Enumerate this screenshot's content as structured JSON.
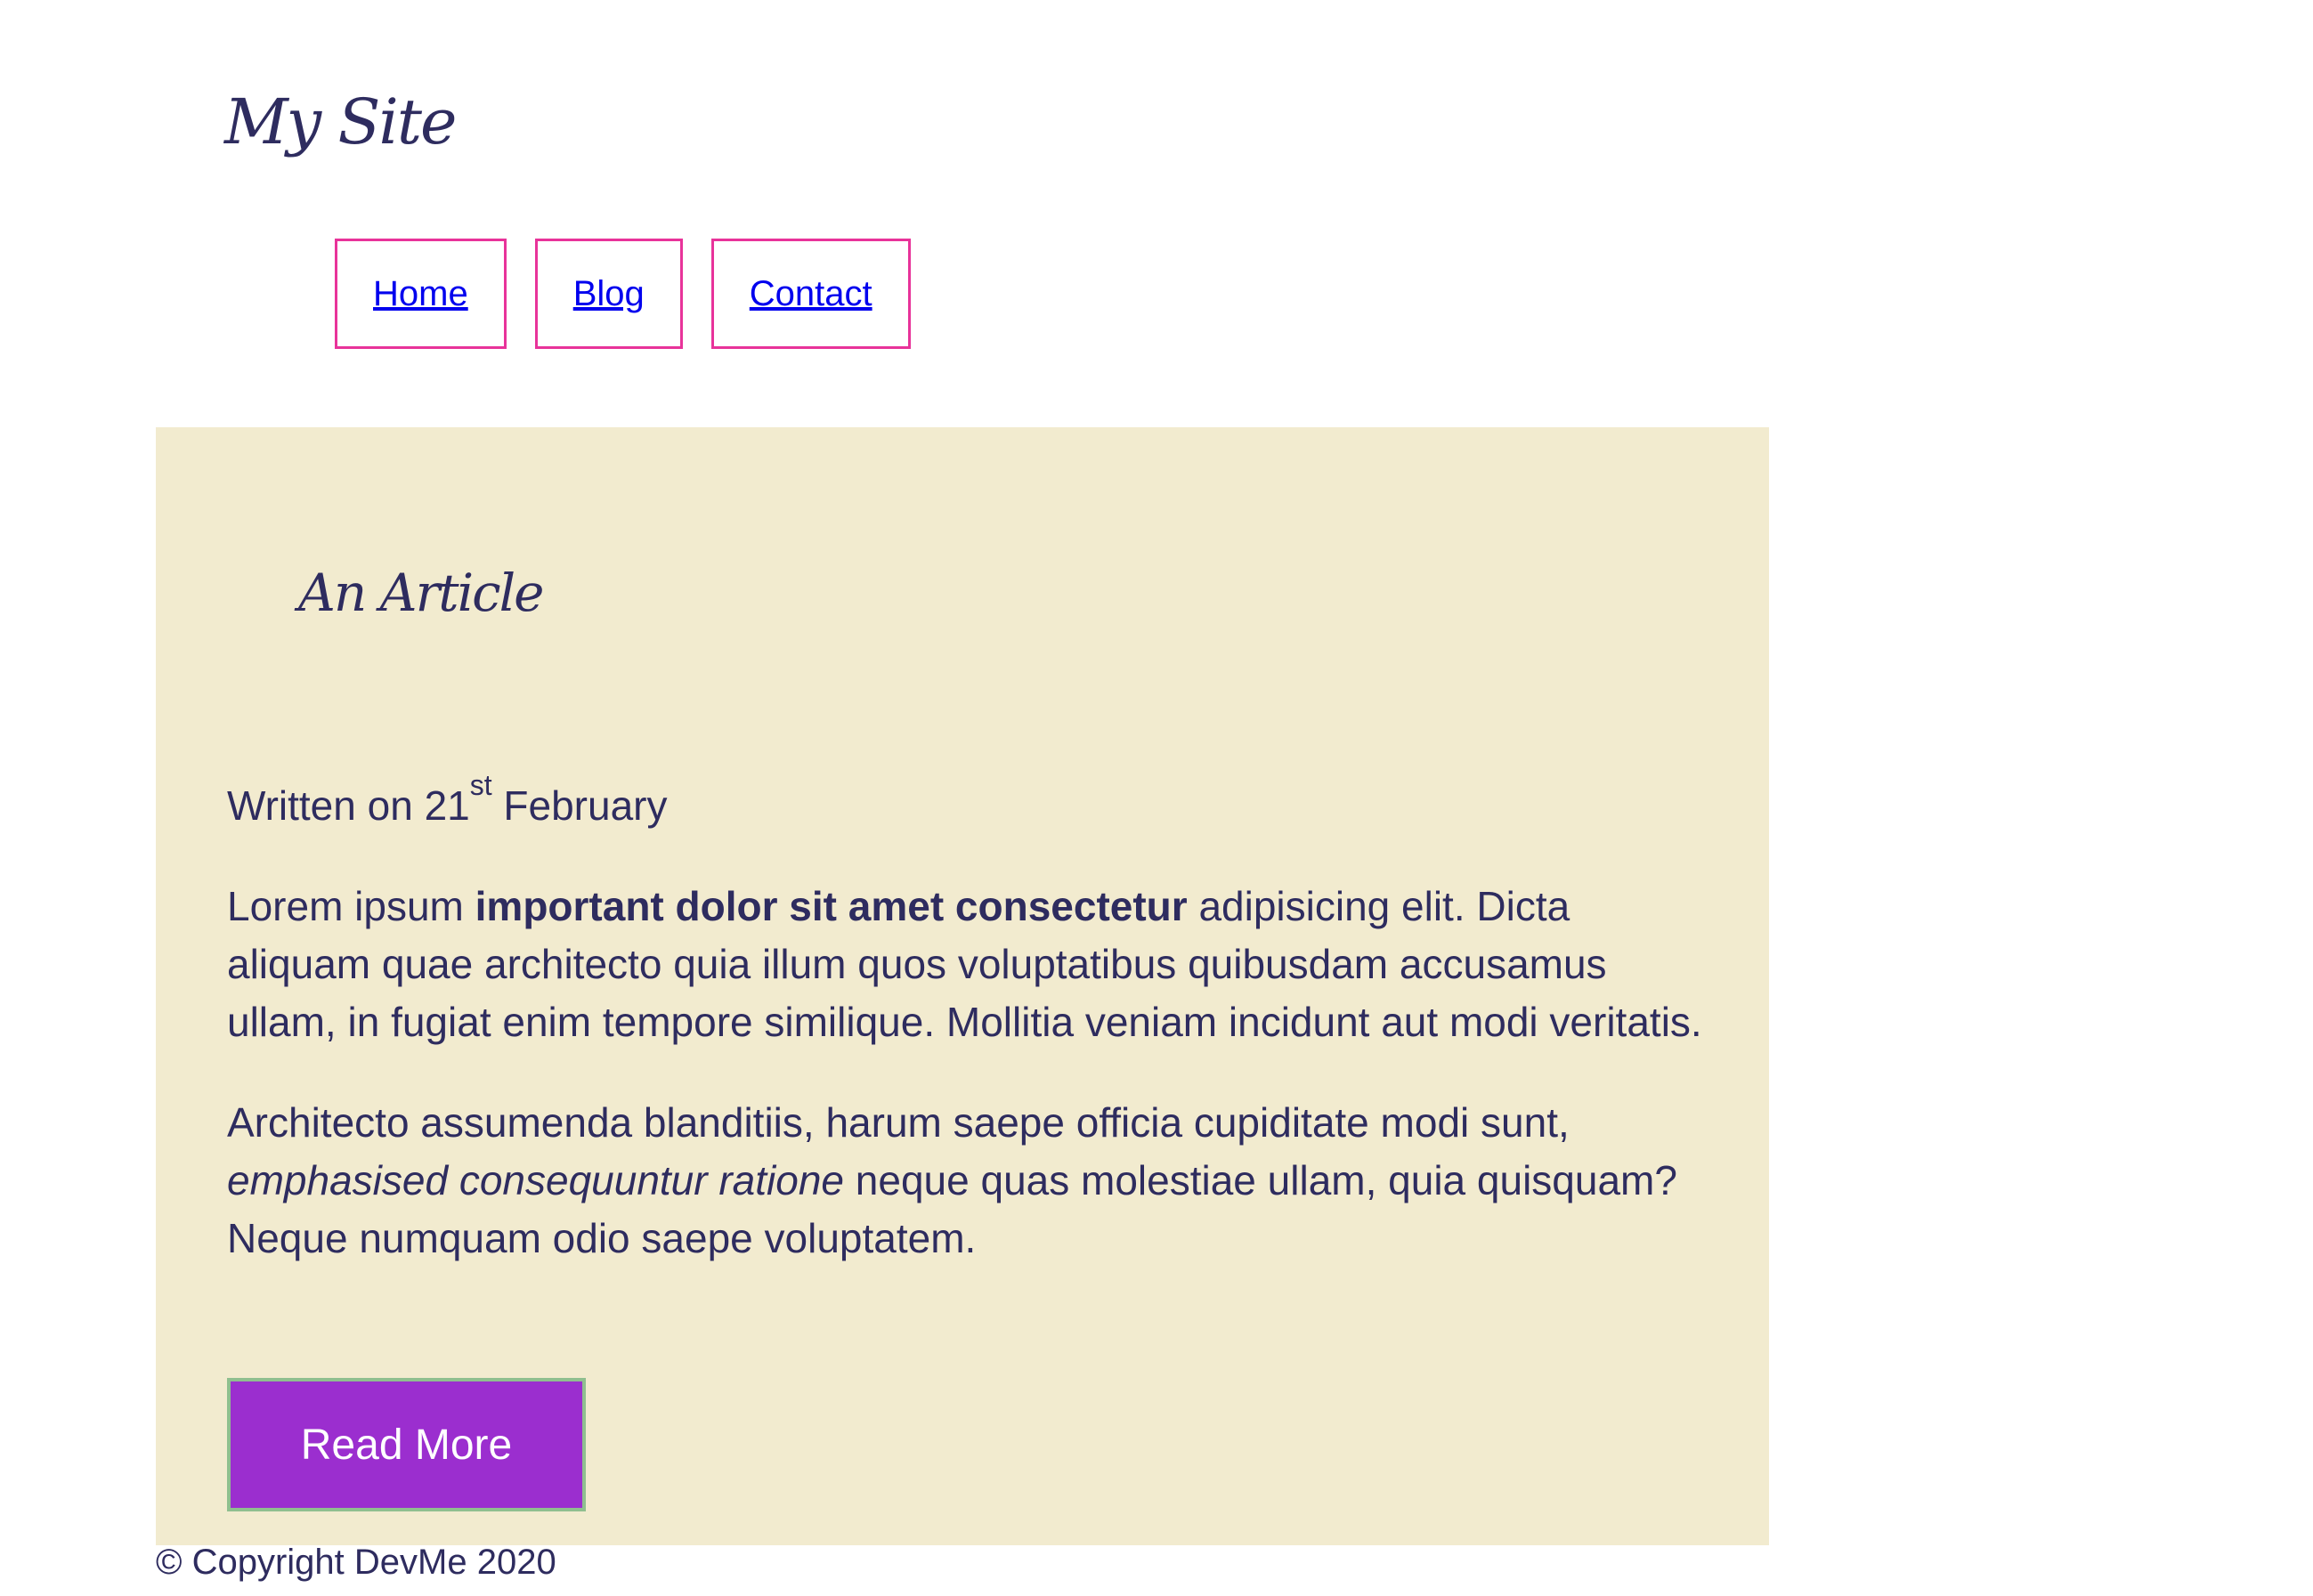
{
  "header": {
    "site_title": "My Site"
  },
  "nav": {
    "items": [
      {
        "label": "Home"
      },
      {
        "label": "Blog"
      },
      {
        "label": "Contact"
      }
    ]
  },
  "article": {
    "title": "An Article",
    "meta": {
      "prefix": "Written on 21",
      "ordinal_suffix": "st",
      "month": "February"
    },
    "paragraph1": {
      "before": "Lorem ipsum ",
      "bold": "important dolor sit amet consectetur",
      "after": " adipisicing elit. Dicta aliquam quae architecto quia illum quos voluptatibus quibusdam accusamus ullam, in fugiat enim tempore similique. Mollitia veniam incidunt aut modi veritatis."
    },
    "paragraph2": {
      "before": "Architecto assumenda blanditiis, harum saepe officia cupiditate modi sunt, ",
      "italic": "emphasised consequuntur ratione",
      "after": " neque quas molestiae ullam, quia quisquam? Neque numquam odio saepe voluptatem."
    },
    "read_more_label": "Read More"
  },
  "footer": {
    "copyright": "© Copyright DevMe 2020"
  },
  "colors": {
    "text": "#2e2c5f",
    "nav_border": "#e8339a",
    "link": "#0000ee",
    "article_bg": "#f2ebcf",
    "button_bg": "#9b2ecf",
    "button_border": "#8fbf8f"
  }
}
